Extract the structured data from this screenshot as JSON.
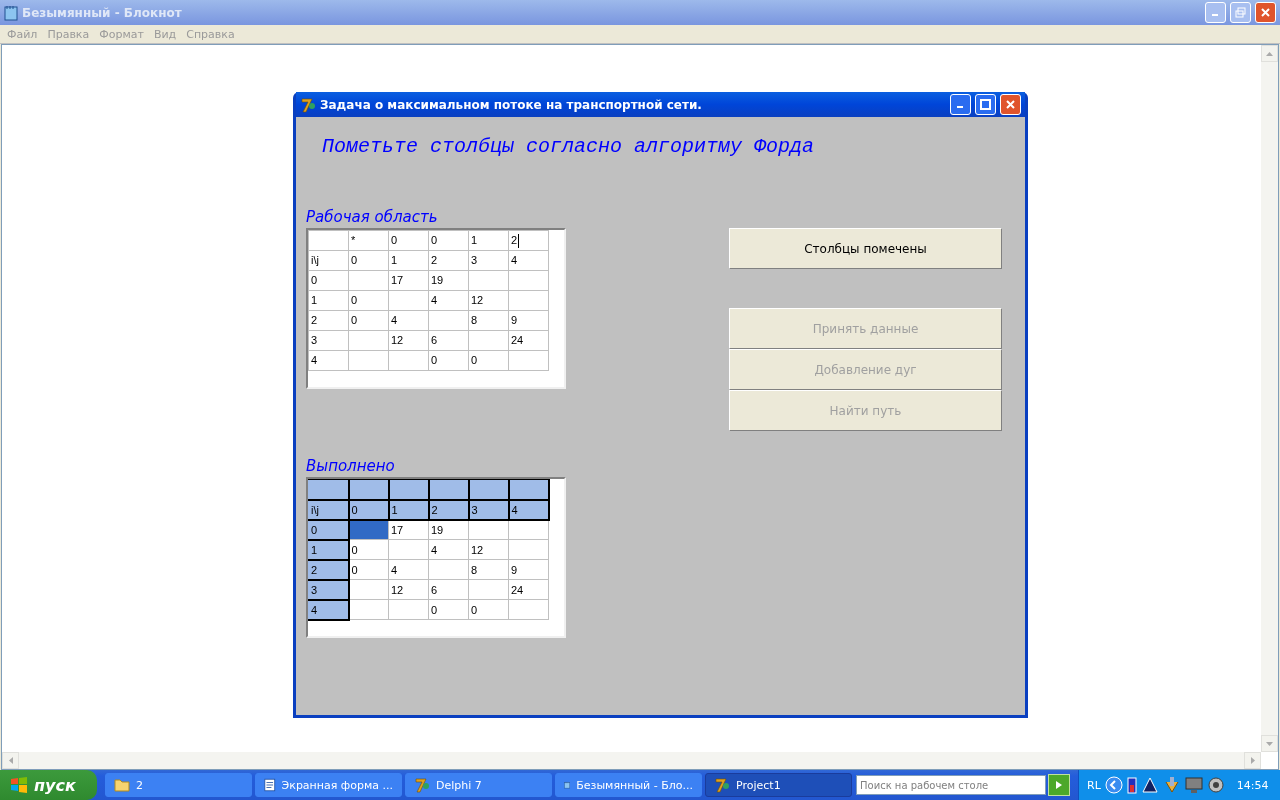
{
  "notepad": {
    "title": "Безымянный - Блокнот",
    "menu": [
      "Файл",
      "Правка",
      "Формат",
      "Вид",
      "Справка"
    ]
  },
  "dialog": {
    "title": "Задача о максимальном потоке на транспортной сети.",
    "heading": "Пометьте столбцы согласно алгоритму Форда",
    "grids": [
      {
        "label": "Рабочая область",
        "kind": "edit",
        "rows": [
          [
            {
              "text": "",
              "selected": false
            },
            {
              "text": "*",
              "selected": false
            },
            {
              "text": "0",
              "selected": false
            },
            {
              "text": "0",
              "selected": false
            },
            {
              "text": "1",
              "selected": false
            },
            {
              "text": "2",
              "selected": true
            }
          ],
          [
            {
              "text": "i\\j",
              "selected": false
            },
            {
              "text": "0",
              "selected": false
            },
            {
              "text": "1",
              "selected": false
            },
            {
              "text": "2",
              "selected": false
            },
            {
              "text": "3",
              "selected": false
            },
            {
              "text": "4",
              "selected": false
            }
          ],
          [
            {
              "text": "0",
              "selected": false
            },
            {
              "text": "",
              "selected": false
            },
            {
              "text": "17",
              "selected": false
            },
            {
              "text": "19",
              "selected": false
            },
            {
              "text": "",
              "selected": false
            },
            {
              "text": "",
              "selected": false
            }
          ],
          [
            {
              "text": "1",
              "selected": false
            },
            {
              "text": "0",
              "selected": false
            },
            {
              "text": "",
              "selected": false
            },
            {
              "text": "4",
              "selected": false
            },
            {
              "text": "12",
              "selected": false
            },
            {
              "text": "",
              "selected": false
            }
          ],
          [
            {
              "text": "2",
              "selected": false
            },
            {
              "text": "0",
              "selected": false
            },
            {
              "text": "4",
              "selected": false
            },
            {
              "text": "",
              "selected": false
            },
            {
              "text": "8",
              "selected": false
            },
            {
              "text": "9",
              "selected": false
            }
          ],
          [
            {
              "text": "3",
              "selected": false
            },
            {
              "text": "",
              "selected": false
            },
            {
              "text": "12",
              "selected": false
            },
            {
              "text": "6",
              "selected": false
            },
            {
              "text": "",
              "selected": false
            },
            {
              "text": "24",
              "selected": false
            }
          ],
          [
            {
              "text": "4",
              "selected": false
            },
            {
              "text": "",
              "selected": false
            },
            {
              "text": "",
              "selected": false
            },
            {
              "text": "0",
              "selected": false
            },
            {
              "text": "0",
              "selected": false
            },
            {
              "text": "",
              "selected": false
            }
          ]
        ]
      },
      {
        "label": "Выполнено",
        "kind": "display",
        "rows": [
          [
            {
              "text": "",
              "selected": false
            },
            {
              "text": "",
              "selected": false
            },
            {
              "text": "",
              "selected": false
            },
            {
              "text": "",
              "selected": false
            },
            {
              "text": "",
              "selected": false
            },
            {
              "text": "",
              "selected": false
            }
          ],
          [
            {
              "text": "i\\j",
              "selected": false
            },
            {
              "text": "0",
              "selected": false
            },
            {
              "text": "1",
              "selected": false
            },
            {
              "text": "2",
              "selected": false
            },
            {
              "text": "3",
              "selected": false
            },
            {
              "text": "4",
              "selected": false
            }
          ],
          [
            {
              "text": "0",
              "selected": false
            },
            {
              "text": "",
              "selected": true
            },
            {
              "text": "17",
              "selected": false
            },
            {
              "text": "19",
              "selected": false
            },
            {
              "text": "",
              "selected": false
            },
            {
              "text": "",
              "selected": false
            }
          ],
          [
            {
              "text": "1",
              "selected": false
            },
            {
              "text": "0",
              "selected": false
            },
            {
              "text": "",
              "selected": false
            },
            {
              "text": "4",
              "selected": false
            },
            {
              "text": "12",
              "selected": false
            },
            {
              "text": "",
              "selected": false
            }
          ],
          [
            {
              "text": "2",
              "selected": false
            },
            {
              "text": "0",
              "selected": false
            },
            {
              "text": "4",
              "selected": false
            },
            {
              "text": "",
              "selected": false
            },
            {
              "text": "8",
              "selected": false
            },
            {
              "text": "9",
              "selected": false
            }
          ],
          [
            {
              "text": "3",
              "selected": false
            },
            {
              "text": "",
              "selected": false
            },
            {
              "text": "12",
              "selected": false
            },
            {
              "text": "6",
              "selected": false
            },
            {
              "text": "",
              "selected": false
            },
            {
              "text": "24",
              "selected": false
            }
          ],
          [
            {
              "text": "4",
              "selected": false
            },
            {
              "text": "",
              "selected": false
            },
            {
              "text": "",
              "selected": false
            },
            {
              "text": "0",
              "selected": false
            },
            {
              "text": "0",
              "selected": false
            },
            {
              "text": "",
              "selected": false
            }
          ]
        ]
      }
    ],
    "primary_button": {
      "label": "Столбцы помечены",
      "disabled": false
    },
    "buttons": [
      {
        "label": "Принять данные",
        "disabled": true
      },
      {
        "label": "Добавление дуг",
        "disabled": true
      },
      {
        "label": "Найти путь",
        "disabled": true
      }
    ]
  },
  "taskbar": {
    "start": "пуск",
    "tasks": [
      {
        "label": "2",
        "kind": "folder",
        "selected": false
      },
      {
        "label": "Экранная форма ...",
        "kind": "document",
        "selected": false
      },
      {
        "label": "Delphi 7",
        "kind": "delphi",
        "selected": false
      },
      {
        "label": "Безымянный - Бло...",
        "kind": "notepad",
        "selected": false
      },
      {
        "label": "Project1",
        "kind": "delphi",
        "selected": true
      }
    ],
    "search": {
      "placeholder": "Поиск на рабочем столе"
    },
    "language": "RL",
    "clock": "14:54"
  }
}
